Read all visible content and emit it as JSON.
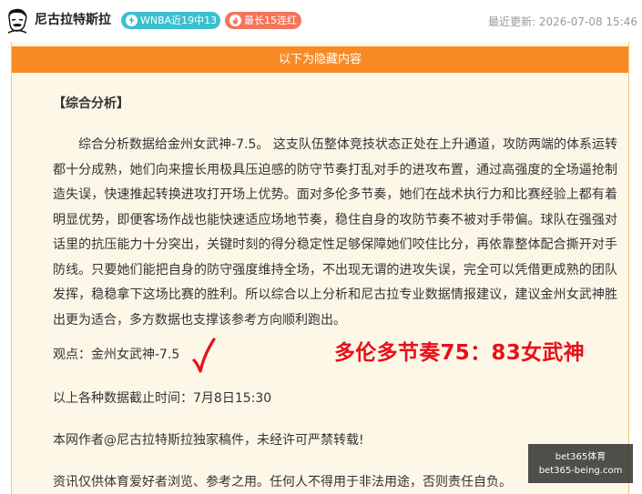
{
  "header": {
    "author_name": "尼古拉特斯拉",
    "badges": [
      {
        "label": "WNBA近19中13",
        "color": "#3cbfcf",
        "icon": "lightning-icon"
      },
      {
        "label": "最长15连红",
        "color": "#f3755a",
        "icon": "flame-icon"
      }
    ],
    "updated_label": "最近更新:",
    "updated_time": "2026-07-08 15:46"
  },
  "content": {
    "hidden_bar_label": "以下为隐藏内容",
    "section_title": "【综合分析】",
    "paragraph": "综合分析数据给金州女武神-7.5。 这支队伍整体竞技状态正处在上升通道，攻防两端的体系运转都十分成熟，她们向来擅长用极具压迫感的防守节奏打乱对手的进攻布置，通过高强度的全场逼抢制造失误，快速推起转换进攻打开场上优势。面对多伦多节奏，她们在战术执行力和比赛经验上都有着明显优势，即便客场作战也能快速适应场地节奏，稳住自身的攻防节奏不被对手带偏。球队在强强对话里的抗压能力十分突出，关键时刻的得分稳定性足够保障她们咬住比分，再依靠整体配合撕开对手防线。只要她们能把自身的防守强度维持全场，不出现无谓的进攻失误，完全可以凭借更成熟的团队发挥，稳稳拿下这场比赛的胜利。所以综合以上分析和尼古拉专业数据情报建议，建议金州女武神胜出更为适合，多方数据也支撑该参考方向顺利跑出。",
    "opinion": "观点：金州女武神-7.5",
    "result": "多伦多节奏75：83女武神",
    "cutoff": "以上各种数据截止时间：7月8日15:30",
    "copyright": "本网作者@尼古拉特斯拉独家稿件，未经许可严禁转载!",
    "disclaimer": "资讯仅供体育爱好者浏览、参考之用。任何人不得用于非法用途，否则责任自负。"
  },
  "watermark": {
    "line1": "bet365体育",
    "line2": "bet365-being.com"
  },
  "colors": {
    "accent_orange": "#f88a26",
    "result_red": "#e8101a",
    "check_red": "#e8101a",
    "box_background": "#fdf7e7"
  }
}
